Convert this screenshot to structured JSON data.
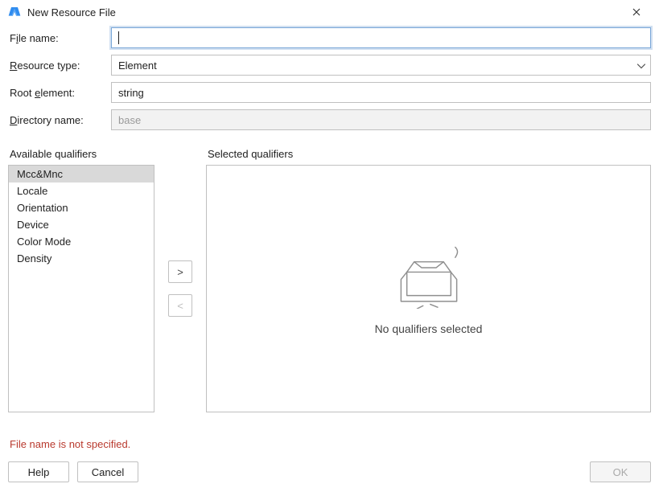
{
  "window": {
    "title": "New Resource File",
    "close_icon": "close-icon"
  },
  "form": {
    "file_name": {
      "label_pre": "F",
      "label_u": "i",
      "label_post": "le name:",
      "value": "",
      "placeholder": ""
    },
    "resource_type": {
      "label_pre": "",
      "label_u": "R",
      "label_post": "esource type:",
      "value": "Element"
    },
    "root_element": {
      "label_pre": "Root ",
      "label_u": "e",
      "label_post": "lement:",
      "value": "string"
    },
    "directory_name": {
      "label_pre": "",
      "label_u": "D",
      "label_post": "irectory name:",
      "value": "base"
    }
  },
  "qualifiers": {
    "available_label": "Available qualifiers",
    "selected_label": "Selected qualifiers",
    "items": [
      {
        "label": "Mcc&Mnc",
        "selected": true
      },
      {
        "label": "Locale",
        "selected": false
      },
      {
        "label": "Orientation",
        "selected": false
      },
      {
        "label": "Device",
        "selected": false
      },
      {
        "label": "Color Mode",
        "selected": false
      },
      {
        "label": "Density",
        "selected": false
      }
    ],
    "add_glyph": ">",
    "remove_glyph": "<",
    "empty_text": "No qualifiers selected"
  },
  "error": "File name is not specified.",
  "buttons": {
    "help": "Help",
    "cancel": "Cancel",
    "ok": "OK"
  }
}
